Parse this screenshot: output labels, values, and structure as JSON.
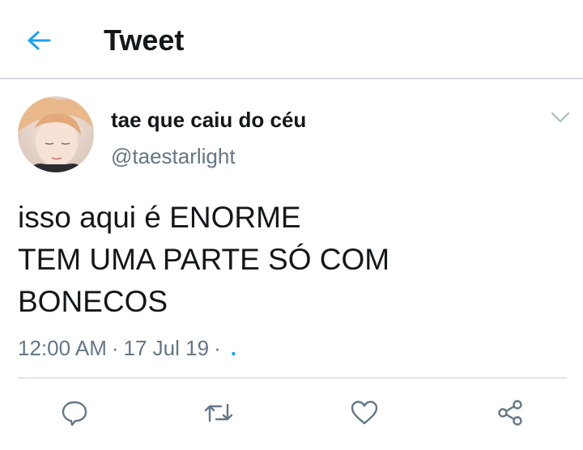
{
  "header": {
    "back_icon": "arrow-left-icon",
    "title": "Tweet"
  },
  "colors": {
    "accent": "#1da1f2",
    "secondary_text": "#657786",
    "primary_text": "#14171a"
  },
  "tweet": {
    "author": {
      "display_name": "tae que caiu do céu",
      "handle": "@taestarlight"
    },
    "text_lines": [
      "isso aqui é ENORME",
      "TEM UMA PARTE SÓ COM",
      "BONECOS"
    ],
    "time": "12:00 AM",
    "separator": "·",
    "date": "17 Jul 19",
    "trailing_dot": "."
  },
  "actions": [
    {
      "icon": "reply-icon"
    },
    {
      "icon": "retweet-icon"
    },
    {
      "icon": "like-icon"
    },
    {
      "icon": "share-icon"
    }
  ]
}
